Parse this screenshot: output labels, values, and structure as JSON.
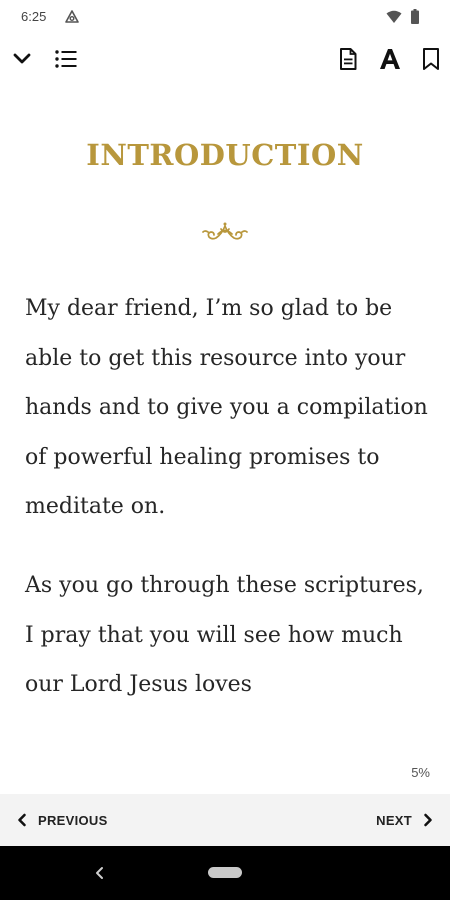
{
  "status_bar": {
    "time": "6:25",
    "app_icon": "android-auto-icon",
    "wifi_icon": "wifi-icon",
    "battery_icon": "battery-icon"
  },
  "toolbar": {
    "collapse_icon": "chevron-down-icon",
    "toc_icon": "list-icon",
    "notes_icon": "document-icon",
    "font_icon": "font-size-icon",
    "bookmark_icon": "bookmark-icon"
  },
  "content": {
    "chapter_title": "INTRODUCTION",
    "ornament_icon": "flourish-ornament-icon",
    "paragraphs": [
      "My dear friend, I’m so glad to be able to get this resource into your hands and to give you a compilation of powerful healing promises to meditate on.",
      "As you go through these scriptures, I pray that you will see how much our Lord Jesus loves"
    ],
    "progress": "5%"
  },
  "bottom_nav": {
    "previous_label": "PREVIOUS",
    "next_label": "NEXT"
  },
  "colors": {
    "accent_gold": "#b8973c",
    "text": "#262626",
    "nav_background": "#f3f3f3",
    "system_bar": "#000000"
  }
}
